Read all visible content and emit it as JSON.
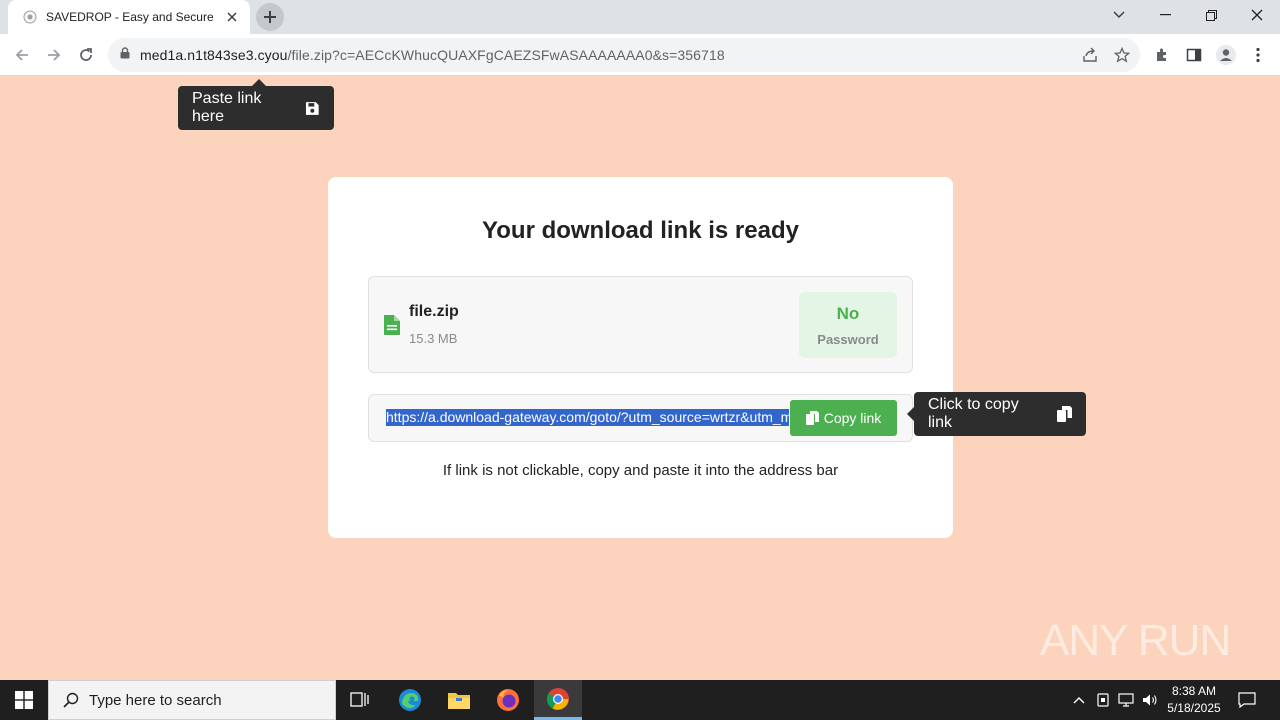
{
  "browser": {
    "tab_title": "SAVEDROP - Easy and Secure File",
    "url_host": "med1a.n1t843se3.cyou",
    "url_path": "/file.zip?c=AECcKWhucQUAXFgCAEZSFwASAAAAAAA0&s=356718"
  },
  "page": {
    "paste_tooltip": "Paste link here",
    "title": "Your download link is ready",
    "file": {
      "name": "file.zip",
      "size": "15.3 MB",
      "password_status": "No",
      "password_label": "Password"
    },
    "link_value": "https://a.download-gateway.com/goto/?utm_source=wrtzr&utm_m",
    "copy_button": "Copy link",
    "copy_tooltip": "Click to copy link",
    "hint": "If link is not clickable, copy and paste it into the address bar"
  },
  "watermark": "ANY RUN",
  "taskbar": {
    "search_placeholder": "Type here to search",
    "time": "8:38 AM",
    "date": "5/18/2025"
  },
  "colors": {
    "page_bg": "#fcd3bc",
    "accent_green": "#4caf50",
    "tooltip_bg": "#2d2d2d",
    "selection": "#3366cc"
  }
}
